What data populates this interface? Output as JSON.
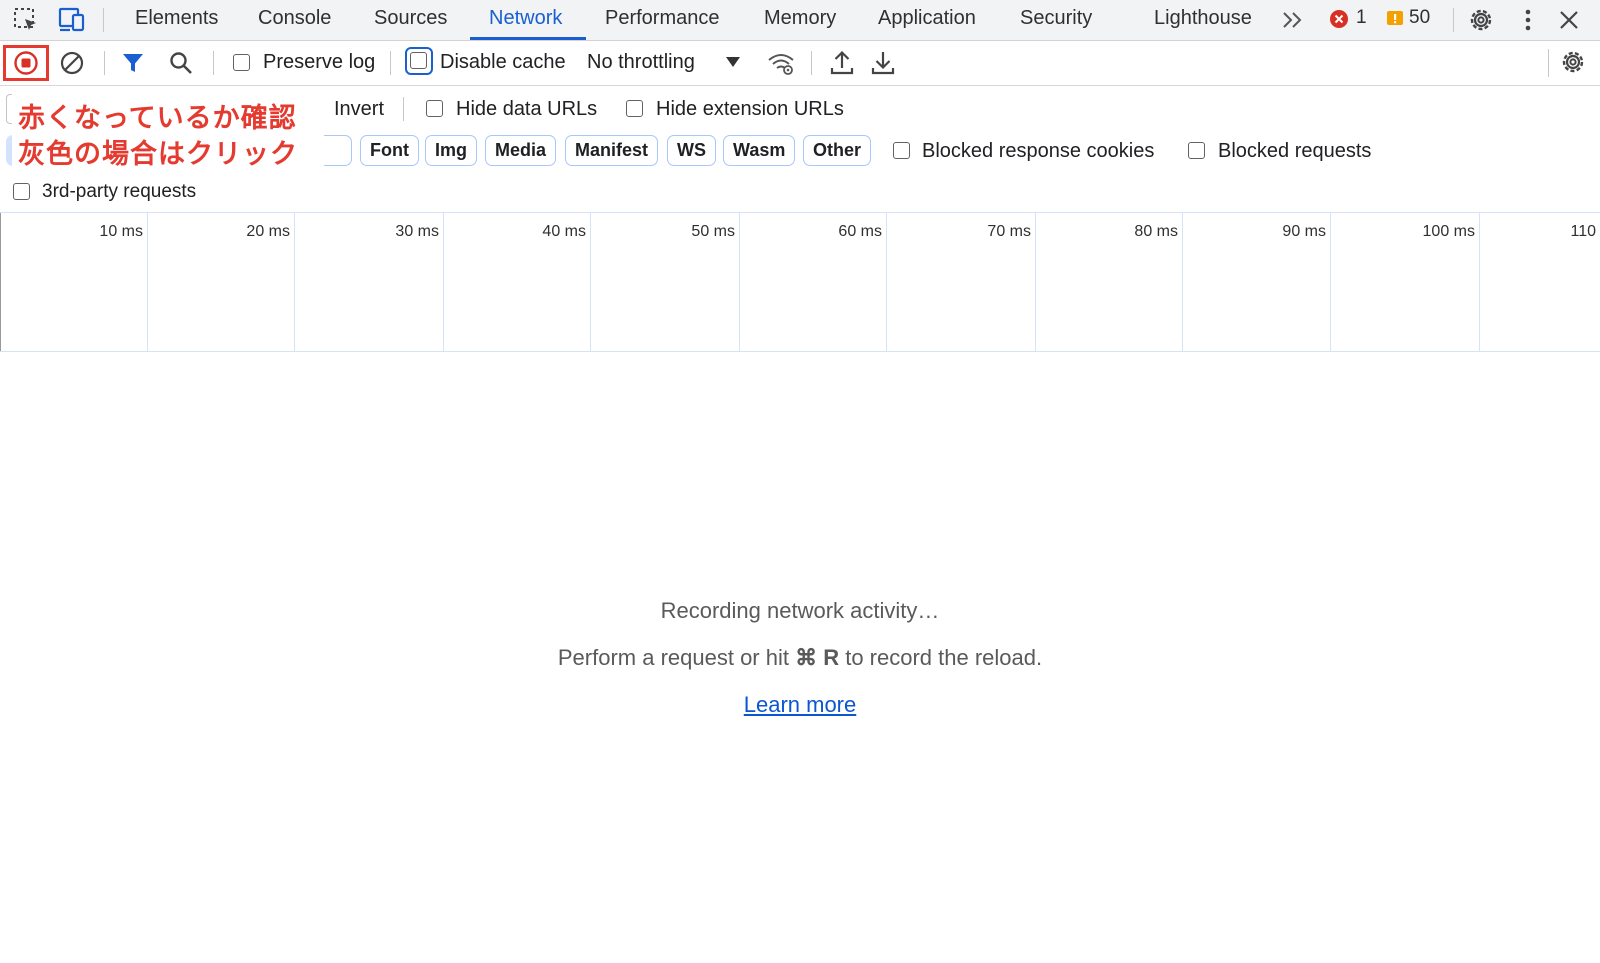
{
  "tabs": [
    "Elements",
    "Console",
    "Sources",
    "Network",
    "Performance",
    "Memory",
    "Application",
    "Security",
    "Lighthouse"
  ],
  "active_tab": "Network",
  "error_count": "1",
  "warning_count": "50",
  "toolbar": {
    "preserve_log": "Preserve log",
    "disable_cache": "Disable cache",
    "throttling": "No throttling"
  },
  "filter": {
    "invert": "Invert",
    "hide_data_urls": "Hide data URLs",
    "hide_extension_urls": "Hide extension URLs",
    "type_chips": [
      "Font",
      "Img",
      "Media",
      "Manifest",
      "WS",
      "Wasm",
      "Other"
    ],
    "blocked_response_cookies": "Blocked response cookies",
    "blocked_requests": "Blocked requests",
    "third_party": "3rd-party requests"
  },
  "timeline_ticks": [
    "10 ms",
    "20 ms",
    "30 ms",
    "40 ms",
    "50 ms",
    "60 ms",
    "70 ms",
    "80 ms",
    "90 ms",
    "100 ms",
    "110"
  ],
  "empty_state": {
    "title": "Recording network activity…",
    "hint_before": "Perform a request or hit ",
    "hint_key": "⌘ R",
    "hint_after": " to record the reload.",
    "link": "Learn more"
  },
  "annotation": {
    "line1": "赤くなっているか確認",
    "line2": "灰色の場合はクリック",
    "color": "#e53a2f"
  },
  "colors": {
    "accent": "#1a5fd1",
    "record": "#d93025",
    "warning": "#f4a100"
  }
}
